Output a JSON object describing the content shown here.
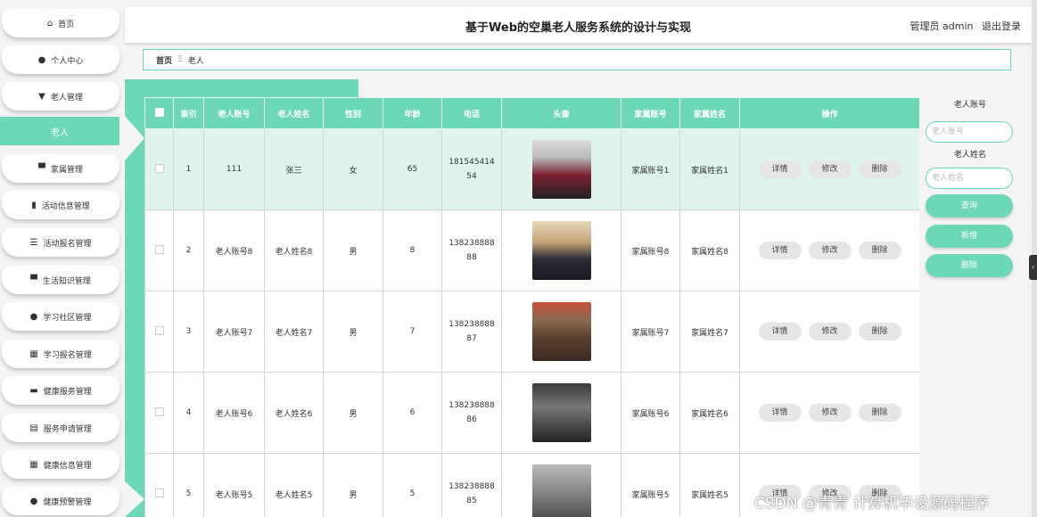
{
  "sidebar": {
    "items": [
      {
        "label": "首页",
        "icon": "home-icon",
        "glyph": "⌂"
      },
      {
        "label": "个人中心",
        "icon": "user-icon",
        "glyph": "●"
      },
      {
        "label": "老人管理",
        "icon": "monitor-icon",
        "glyph": "▼"
      },
      {
        "label": "家属管理",
        "icon": "monitor-icon",
        "glyph": "▀"
      },
      {
        "label": "活动信息管理",
        "icon": "chart-icon",
        "glyph": "▮"
      },
      {
        "label": "活动报名管理",
        "icon": "list-icon",
        "glyph": "☰"
      },
      {
        "label": "生活知识管理",
        "icon": "monitor-icon",
        "glyph": "▀"
      },
      {
        "label": "学习社区管理",
        "icon": "user-icon",
        "glyph": "●"
      },
      {
        "label": "学习报名管理",
        "icon": "grid-icon",
        "glyph": "▦"
      },
      {
        "label": "健康服务管理",
        "icon": "id-card-icon",
        "glyph": "▬"
      },
      {
        "label": "服务申请管理",
        "icon": "document-icon",
        "glyph": "▤"
      },
      {
        "label": "健康信息管理",
        "icon": "grid-icon",
        "glyph": "▦"
      },
      {
        "label": "健康预警管理",
        "icon": "user-icon",
        "glyph": "●"
      }
    ],
    "active_sub": "老人"
  },
  "header": {
    "title": "基于Web的空巢老人服务系统的设计与实现",
    "user": "管理员 admin",
    "logout": "退出登录"
  },
  "breadcrumb": {
    "home": "首页",
    "separator": "Ξ",
    "current": "老人"
  },
  "table": {
    "headers": [
      "索引",
      "老人账号",
      "老人姓名",
      "性别",
      "年龄",
      "电话",
      "头像",
      "家属账号",
      "家属姓名",
      "操作"
    ],
    "actions": {
      "detail": "详情",
      "edit": "修改",
      "delete": "删除"
    },
    "rows": [
      {
        "index": "1",
        "account": "111",
        "name": "张三",
        "gender": "女",
        "age": "65",
        "phone1": "181545414",
        "phone2": "54",
        "family_account": "家属账号1",
        "family_name": "家属姓名1"
      },
      {
        "index": "2",
        "account": "老人账号8",
        "name": "老人姓名8",
        "gender": "男",
        "age": "8",
        "phone1": "138238888",
        "phone2": "88",
        "family_account": "家属账号8",
        "family_name": "家属姓名8"
      },
      {
        "index": "3",
        "account": "老人账号7",
        "name": "老人姓名7",
        "gender": "男",
        "age": "7",
        "phone1": "138238888",
        "phone2": "87",
        "family_account": "家属账号7",
        "family_name": "家属姓名7"
      },
      {
        "index": "4",
        "account": "老人账号6",
        "name": "老人姓名6",
        "gender": "男",
        "age": "6",
        "phone1": "138238888",
        "phone2": "86",
        "family_account": "家属账号6",
        "family_name": "家属姓名6"
      },
      {
        "index": "5",
        "account": "老人账号5",
        "name": "老人姓名5",
        "gender": "男",
        "age": "5",
        "phone1": "138238888",
        "phone2": "85",
        "family_account": "家属账号5",
        "family_name": "家属姓名5"
      }
    ]
  },
  "search": {
    "account_label": "老人账号",
    "account_placeholder": "老人账号",
    "name_label": "老人姓名",
    "name_placeholder": "老人姓名",
    "query_button": "查询",
    "add_button": "新增",
    "delete_button": "删除"
  },
  "watermark": "CSDN @青青  计算机毕设源码程序",
  "colors": {
    "accent": "#6dd8b7",
    "highlight_row": "#dff4ed"
  }
}
